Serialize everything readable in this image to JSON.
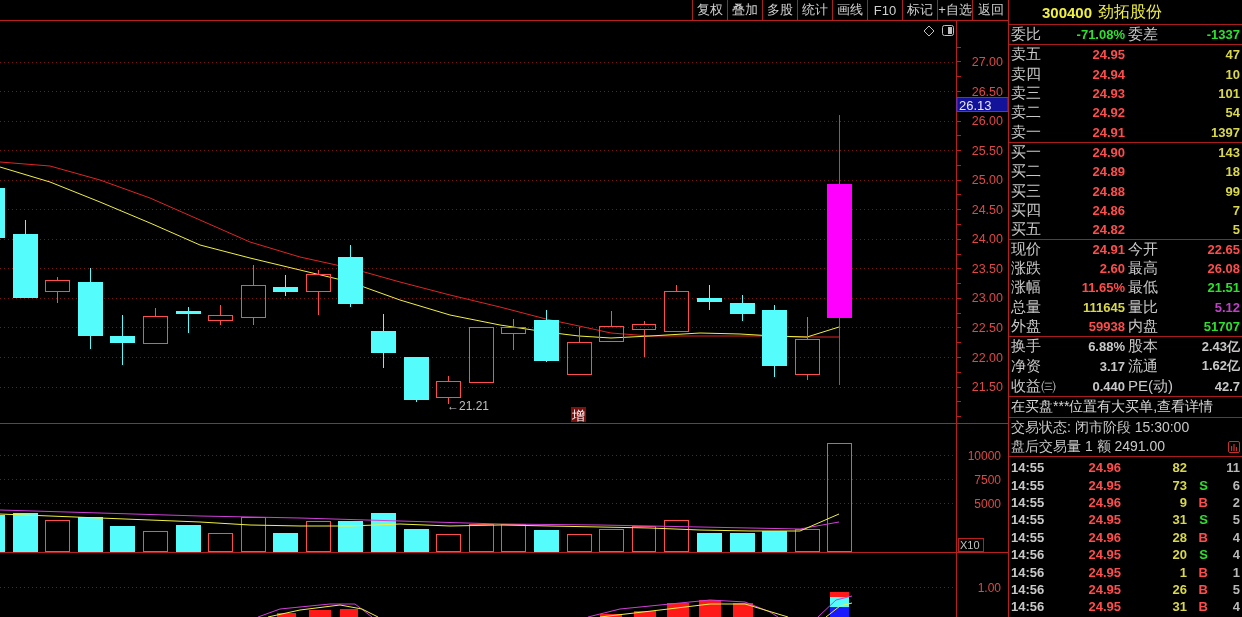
{
  "toolbar": {
    "buttons": [
      "复权",
      "叠加",
      "多股",
      "统计",
      "画线",
      "F10",
      "标记",
      "+自选",
      "返回"
    ]
  },
  "price_chart": {
    "axis_ticks": [
      "27.00",
      "26.50",
      "26.00",
      "25.50",
      "25.00",
      "24.50",
      "24.00",
      "23.50",
      "23.00",
      "22.50",
      "22.00",
      "21.50"
    ],
    "current_price_tag": "26.13",
    "low_marker": "←21.21",
    "event_badge": "增"
  },
  "volume_chart": {
    "axis_ticks": [
      "10000",
      "7500",
      "5000"
    ],
    "scale_label": "X10"
  },
  "indicator_chart": {
    "axis_ticks": [
      "1.00"
    ]
  },
  "quote_panel": {
    "code": "300400",
    "name": "劲拓股份",
    "order_ratio": [
      {
        "label": "委比",
        "value": "-71.08%",
        "color": "#2ee02e"
      },
      {
        "label": "委差",
        "value": "-1337",
        "color": "#2ee02e"
      }
    ],
    "asks": [
      {
        "label": "卖五",
        "price": "24.95",
        "volume": "47"
      },
      {
        "label": "卖四",
        "price": "24.94",
        "volume": "10"
      },
      {
        "label": "卖三",
        "price": "24.93",
        "volume": "101"
      },
      {
        "label": "卖二",
        "price": "24.92",
        "volume": "54"
      },
      {
        "label": "卖一",
        "price": "24.91",
        "volume": "1397"
      }
    ],
    "bids": [
      {
        "label": "买一",
        "price": "24.90",
        "volume": "143"
      },
      {
        "label": "买二",
        "price": "24.89",
        "volume": "18"
      },
      {
        "label": "买三",
        "price": "24.88",
        "volume": "99"
      },
      {
        "label": "买四",
        "price": "24.86",
        "volume": "7"
      },
      {
        "label": "买五",
        "price": "24.82",
        "volume": "5"
      }
    ],
    "quote": [
      {
        "label": "现价",
        "value": "24.91",
        "color": "#ff4c4c"
      },
      {
        "label": "今开",
        "value": "22.65",
        "color": "#ff4c4c"
      },
      {
        "label": "涨跌",
        "value": "2.60",
        "color": "#ff4c4c"
      },
      {
        "label": "最高",
        "value": "26.08",
        "color": "#ff4c4c"
      },
      {
        "label": "涨幅",
        "value": "11.65%",
        "color": "#ff4c4c"
      },
      {
        "label": "最低",
        "value": "21.51",
        "color": "#2ee02e"
      },
      {
        "label": "总量",
        "value": "111645",
        "color": "#d8d84a"
      },
      {
        "label": "量比",
        "value": "5.12",
        "color": "#c040c8"
      },
      {
        "label": "外盘",
        "value": "59938",
        "color": "#ff4c4c"
      },
      {
        "label": "内盘",
        "value": "51707",
        "color": "#2ee02e"
      }
    ],
    "stats": [
      {
        "label": "换手",
        "value": "6.88%"
      },
      {
        "label": "股本",
        "value": "2.43亿"
      },
      {
        "label": "净资",
        "value": "3.17"
      },
      {
        "label": "流通",
        "value": "1.62亿"
      },
      {
        "label": "收益㈢",
        "value": "0.440"
      },
      {
        "label": "PE(动)",
        "value": "42.7"
      }
    ],
    "notice": "在买盘***位置有大买单,查看详情",
    "trade_status": "交易状态: 闭市阶段 15:30:00",
    "after_hours": "盘后交易量 1 额 2491.00",
    "ticks": [
      {
        "time": "14:55",
        "price": "24.96",
        "volume": "82",
        "count": "11"
      },
      {
        "time": "14:55",
        "price": "24.95",
        "volume": "73",
        "side": "S",
        "color": "#2ee02e",
        "count": "6"
      },
      {
        "time": "14:55",
        "price": "24.96",
        "volume": "9",
        "side": "B",
        "color": "#ff4c4c",
        "count": "2"
      },
      {
        "time": "14:55",
        "price": "24.95",
        "volume": "31",
        "side": "S",
        "color": "#2ee02e",
        "count": "5"
      },
      {
        "time": "14:55",
        "price": "24.96",
        "volume": "28",
        "side": "B",
        "color": "#ff4c4c",
        "count": "4"
      },
      {
        "time": "14:56",
        "price": "24.95",
        "volume": "20",
        "side": "S",
        "color": "#2ee02e",
        "count": "4"
      },
      {
        "time": "14:56",
        "price": "24.95",
        "volume": "1",
        "side": "B",
        "color": "#ff4c4c",
        "count": "1"
      },
      {
        "time": "14:56",
        "price": "24.95",
        "volume": "26",
        "side": "B",
        "color": "#ff4c4c",
        "count": "5"
      },
      {
        "time": "14:56",
        "price": "24.95",
        "volume": "31",
        "side": "B",
        "color": "#ff4c4c",
        "count": "4"
      }
    ]
  }
}
